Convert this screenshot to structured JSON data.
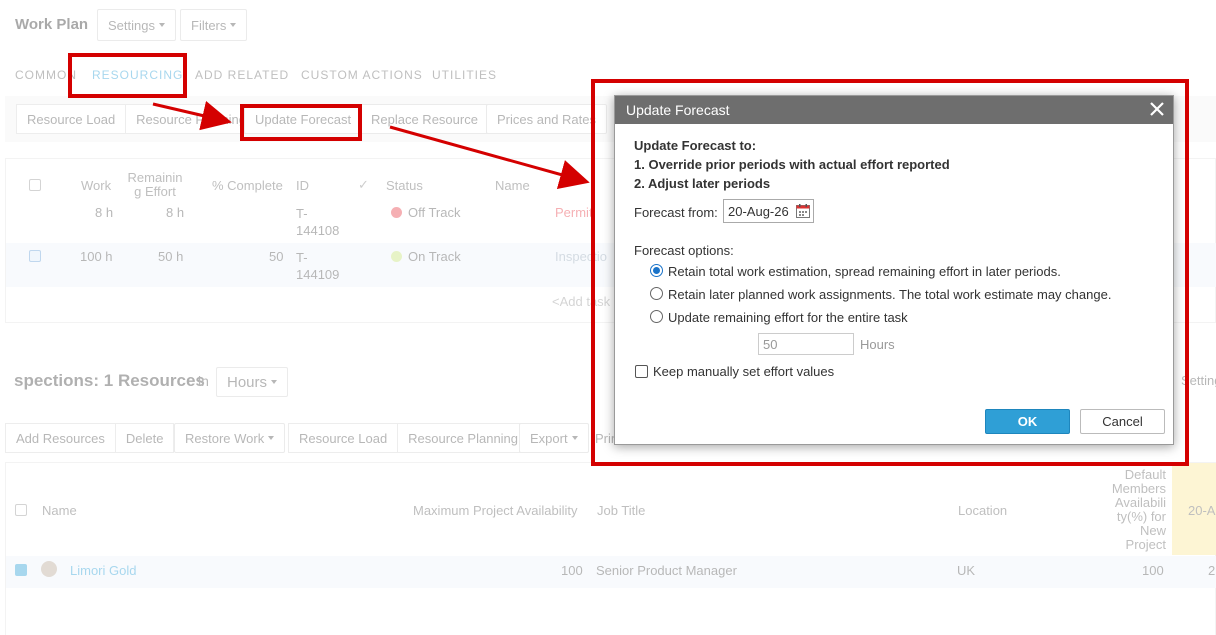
{
  "header": {
    "title": "Work Plan",
    "settings_label": "Settings",
    "filters_label": "Filters"
  },
  "tabs": [
    "COMMON",
    "RESOURCING",
    "ADD RELATED",
    "CUSTOM ACTIONS",
    "UTILITIES"
  ],
  "toolbar": {
    "resource_load": "Resource Load",
    "resource_planning": "Resource Planning",
    "update_forecast": "Update Forecast",
    "replace_resource": "Replace Resource",
    "prices_and_rates": "Prices and Rates"
  },
  "task_table": {
    "headers": {
      "work": "Work",
      "remaining_effort": "Remainin g Effort",
      "pct_complete": "% Complete",
      "id": "ID",
      "status": "Status",
      "name": "Name"
    },
    "rows": [
      {
        "work": "8 h",
        "remaining": "8 h",
        "pct": "",
        "id": "T-144108",
        "status": "Off Track",
        "name": "Permit"
      },
      {
        "work": "100 h",
        "remaining": "50 h",
        "pct": "50",
        "id": "T-144109",
        "status": "On Track",
        "name": "Inspectio"
      }
    ],
    "add_task": "<Add task"
  },
  "resources_section": {
    "title": "spections:",
    "count": "1 Resources",
    "in_label": "in",
    "unit": "Hours",
    "settings_partial": "Setting",
    "buttons": {
      "add_resources": "Add Resources",
      "delete": "Delete",
      "restore_work": "Restore Work",
      "resource_load": "Resource Load",
      "resource_planning": "Resource Planning",
      "export": "Export",
      "print_partial": "Prin"
    },
    "headers": {
      "name": "Name",
      "max_avail": "Maximum Project Availability",
      "job_title": "Job Title",
      "location": "Location",
      "default_avail": "Default Members Availabili ty(%) for New Project",
      "date_col": "20-A"
    },
    "row": {
      "name": "Limori Gold",
      "max_avail": "100",
      "job_title": "Senior Product Manager",
      "location": "UK",
      "default_avail": "100",
      "date_val": "2"
    }
  },
  "dialog": {
    "title": "Update Forecast",
    "intro": "Update Forecast to:",
    "line1": "1. Override prior periods with actual effort reported",
    "line2": "2. Adjust later periods",
    "forecast_from_label": "Forecast from:",
    "forecast_from_value": "20-Aug-26",
    "options_label": "Forecast options:",
    "option1": "Retain total work estimation, spread remaining effort in later periods.",
    "option2": "Retain later planned work assignments. The total work estimate may change.",
    "option3": "Update remaining effort for the entire task",
    "hours_value": "50",
    "hours_unit": "Hours",
    "keep_manual": "Keep manually set effort values",
    "ok": "OK",
    "cancel": "Cancel",
    "selected_option": 1
  },
  "colors": {
    "annotation_red": "#d40000",
    "ok_button": "#2f9fd6",
    "dialog_title_bg": "#6e6e6e",
    "tab_active": "#2f9fd6",
    "on_track": "#a8d84a",
    "off_track": "#e8424a"
  }
}
